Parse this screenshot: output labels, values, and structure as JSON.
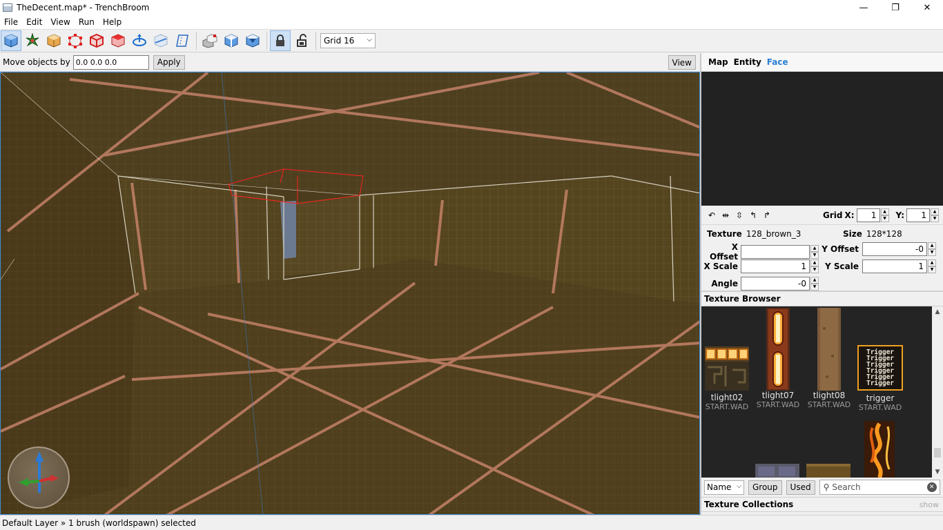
{
  "window": {
    "title": "TheDecent.map* - TrenchBroom",
    "minimize": "—",
    "maximize": "❐",
    "close": "✕"
  },
  "menu": [
    "File",
    "Edit",
    "View",
    "Run",
    "Help"
  ],
  "toolbar": {
    "grid_select": "Grid 16",
    "icons": [
      "select-tool",
      "create-entity-tool",
      "brush-tool",
      "vertex-tool",
      "edge-tool",
      "face-tool",
      "rotate-tool",
      "clip-tool",
      "shear-tool",
      "duplicate",
      "flip-horizontal",
      "flip-vertical",
      "texture-lock",
      "uv-lock"
    ]
  },
  "move_bar": {
    "label": "Move objects by",
    "value": "0.0 0.0 0.0",
    "apply": "Apply",
    "view": "View"
  },
  "status": "Default Layer » 1 brush (worldspawn) selected",
  "inspector": {
    "tabs": [
      "Map",
      "Entity",
      "Face"
    ],
    "selected_tab": "Face",
    "uv": {
      "grid_label": "Grid",
      "x_label": "X:",
      "x_value": "1",
      "y_label": "Y:",
      "y_value": "1"
    },
    "face": {
      "texture_label": "Texture",
      "texture_value": "128_brown_3",
      "size_label": "Size",
      "size_value": "128*128",
      "x_offset_label": "X Offset",
      "x_offset_value": "",
      "y_offset_label": "Y Offset",
      "y_offset_value": "-0",
      "x_scale_label": "X Scale",
      "x_scale_value": "1",
      "y_scale_label": "Y Scale",
      "y_scale_value": "1",
      "angle_label": "Angle",
      "angle_value": "-0"
    }
  },
  "texture_browser": {
    "title": "Texture Browser",
    "textures": [
      {
        "name": "tlight02",
        "collection": "START.WAD"
      },
      {
        "name": "tlight07",
        "collection": "START.WAD"
      },
      {
        "name": "tlight08",
        "collection": "START.WAD"
      },
      {
        "name": "trigger",
        "collection": "START.WAD",
        "preview_text": "Trigger"
      }
    ],
    "sort": "Name",
    "group": "Group",
    "used": "Used",
    "search_placeholder": "Search"
  },
  "texture_collections": {
    "title": "Texture Collections",
    "show": "show"
  },
  "colors": {
    "accent": "#2a7fd3",
    "viewport_bg": "#4a3c1c",
    "selection": "#ff2020"
  }
}
